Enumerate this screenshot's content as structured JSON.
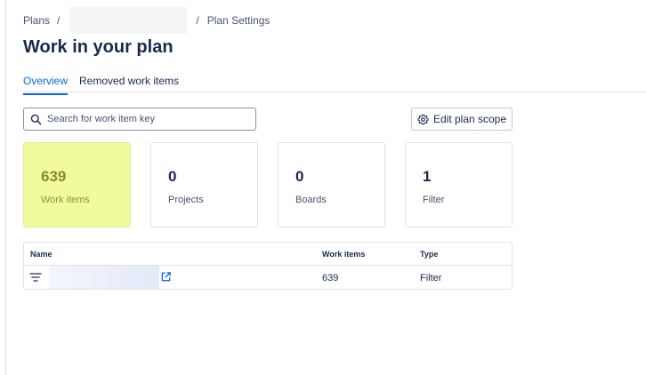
{
  "breadcrumb": {
    "plans_label": "Plans",
    "separator": "/",
    "current_label": "Plan Settings"
  },
  "page": {
    "title": "Work in your plan"
  },
  "tabs": [
    {
      "label": "Overview",
      "active": true
    },
    {
      "label": "Removed work items",
      "active": false
    }
  ],
  "search": {
    "placeholder": "Search for work item key",
    "value": "",
    "icon": "search-icon"
  },
  "toolbar": {
    "edit_scope_label": "Edit plan scope",
    "edit_scope_icon": "gear-icon"
  },
  "stats": [
    {
      "value": "639",
      "label": "Work items",
      "highlighted": true
    },
    {
      "value": "0",
      "label": "Projects",
      "highlighted": false
    },
    {
      "value": "0",
      "label": "Boards",
      "highlighted": false
    },
    {
      "value": "1",
      "label": "Filter",
      "highlighted": false
    }
  ],
  "table": {
    "columns": [
      "Name",
      "Work items",
      "Type"
    ],
    "rows": [
      {
        "icon": "filter-icon",
        "name": "",
        "work_items": "639",
        "type": "Filter",
        "link_icon": "external-link-icon"
      }
    ]
  },
  "colors": {
    "accent": "#0c66e4",
    "highlight": "#f1fa9c",
    "text": "#172b4d",
    "subtle_text": "#44546f",
    "border": "#dfe1e6"
  }
}
